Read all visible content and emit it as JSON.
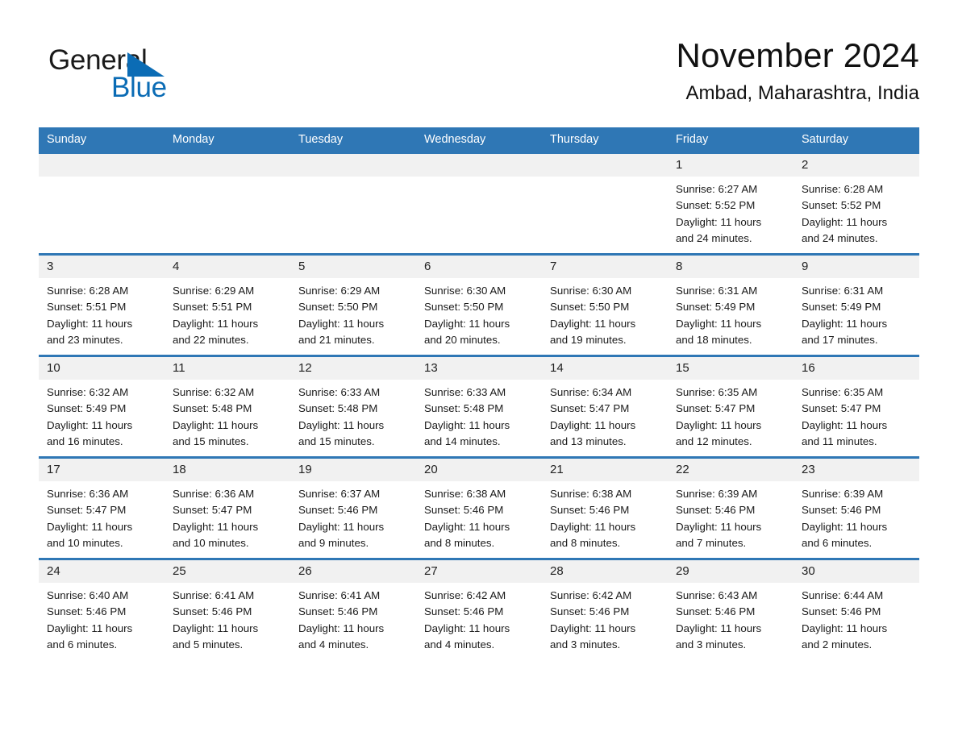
{
  "brand": {
    "name_part1": "General",
    "name_part2": "Blue",
    "accent_color": "#0b6cb5"
  },
  "header": {
    "month_title": "November 2024",
    "location": "Ambad, Maharashtra, India"
  },
  "theme": {
    "header_bar_color": "#2f77b5",
    "daynum_bg": "#f1f1f1"
  },
  "weekdays": [
    "Sunday",
    "Monday",
    "Tuesday",
    "Wednesday",
    "Thursday",
    "Friday",
    "Saturday"
  ],
  "weeks": [
    [
      {
        "day": "",
        "sunrise": "",
        "sunset": "",
        "daylight_line1": "",
        "daylight_line2": ""
      },
      {
        "day": "",
        "sunrise": "",
        "sunset": "",
        "daylight_line1": "",
        "daylight_line2": ""
      },
      {
        "day": "",
        "sunrise": "",
        "sunset": "",
        "daylight_line1": "",
        "daylight_line2": ""
      },
      {
        "day": "",
        "sunrise": "",
        "sunset": "",
        "daylight_line1": "",
        "daylight_line2": ""
      },
      {
        "day": "",
        "sunrise": "",
        "sunset": "",
        "daylight_line1": "",
        "daylight_line2": ""
      },
      {
        "day": "1",
        "sunrise": "Sunrise: 6:27 AM",
        "sunset": "Sunset: 5:52 PM",
        "daylight_line1": "Daylight: 11 hours",
        "daylight_line2": "and 24 minutes."
      },
      {
        "day": "2",
        "sunrise": "Sunrise: 6:28 AM",
        "sunset": "Sunset: 5:52 PM",
        "daylight_line1": "Daylight: 11 hours",
        "daylight_line2": "and 24 minutes."
      }
    ],
    [
      {
        "day": "3",
        "sunrise": "Sunrise: 6:28 AM",
        "sunset": "Sunset: 5:51 PM",
        "daylight_line1": "Daylight: 11 hours",
        "daylight_line2": "and 23 minutes."
      },
      {
        "day": "4",
        "sunrise": "Sunrise: 6:29 AM",
        "sunset": "Sunset: 5:51 PM",
        "daylight_line1": "Daylight: 11 hours",
        "daylight_line2": "and 22 minutes."
      },
      {
        "day": "5",
        "sunrise": "Sunrise: 6:29 AM",
        "sunset": "Sunset: 5:50 PM",
        "daylight_line1": "Daylight: 11 hours",
        "daylight_line2": "and 21 minutes."
      },
      {
        "day": "6",
        "sunrise": "Sunrise: 6:30 AM",
        "sunset": "Sunset: 5:50 PM",
        "daylight_line1": "Daylight: 11 hours",
        "daylight_line2": "and 20 minutes."
      },
      {
        "day": "7",
        "sunrise": "Sunrise: 6:30 AM",
        "sunset": "Sunset: 5:50 PM",
        "daylight_line1": "Daylight: 11 hours",
        "daylight_line2": "and 19 minutes."
      },
      {
        "day": "8",
        "sunrise": "Sunrise: 6:31 AM",
        "sunset": "Sunset: 5:49 PM",
        "daylight_line1": "Daylight: 11 hours",
        "daylight_line2": "and 18 minutes."
      },
      {
        "day": "9",
        "sunrise": "Sunrise: 6:31 AM",
        "sunset": "Sunset: 5:49 PM",
        "daylight_line1": "Daylight: 11 hours",
        "daylight_line2": "and 17 minutes."
      }
    ],
    [
      {
        "day": "10",
        "sunrise": "Sunrise: 6:32 AM",
        "sunset": "Sunset: 5:49 PM",
        "daylight_line1": "Daylight: 11 hours",
        "daylight_line2": "and 16 minutes."
      },
      {
        "day": "11",
        "sunrise": "Sunrise: 6:32 AM",
        "sunset": "Sunset: 5:48 PM",
        "daylight_line1": "Daylight: 11 hours",
        "daylight_line2": "and 15 minutes."
      },
      {
        "day": "12",
        "sunrise": "Sunrise: 6:33 AM",
        "sunset": "Sunset: 5:48 PM",
        "daylight_line1": "Daylight: 11 hours",
        "daylight_line2": "and 15 minutes."
      },
      {
        "day": "13",
        "sunrise": "Sunrise: 6:33 AM",
        "sunset": "Sunset: 5:48 PM",
        "daylight_line1": "Daylight: 11 hours",
        "daylight_line2": "and 14 minutes."
      },
      {
        "day": "14",
        "sunrise": "Sunrise: 6:34 AM",
        "sunset": "Sunset: 5:47 PM",
        "daylight_line1": "Daylight: 11 hours",
        "daylight_line2": "and 13 minutes."
      },
      {
        "day": "15",
        "sunrise": "Sunrise: 6:35 AM",
        "sunset": "Sunset: 5:47 PM",
        "daylight_line1": "Daylight: 11 hours",
        "daylight_line2": "and 12 minutes."
      },
      {
        "day": "16",
        "sunrise": "Sunrise: 6:35 AM",
        "sunset": "Sunset: 5:47 PM",
        "daylight_line1": "Daylight: 11 hours",
        "daylight_line2": "and 11 minutes."
      }
    ],
    [
      {
        "day": "17",
        "sunrise": "Sunrise: 6:36 AM",
        "sunset": "Sunset: 5:47 PM",
        "daylight_line1": "Daylight: 11 hours",
        "daylight_line2": "and 10 minutes."
      },
      {
        "day": "18",
        "sunrise": "Sunrise: 6:36 AM",
        "sunset": "Sunset: 5:47 PM",
        "daylight_line1": "Daylight: 11 hours",
        "daylight_line2": "and 10 minutes."
      },
      {
        "day": "19",
        "sunrise": "Sunrise: 6:37 AM",
        "sunset": "Sunset: 5:46 PM",
        "daylight_line1": "Daylight: 11 hours",
        "daylight_line2": "and 9 minutes."
      },
      {
        "day": "20",
        "sunrise": "Sunrise: 6:38 AM",
        "sunset": "Sunset: 5:46 PM",
        "daylight_line1": "Daylight: 11 hours",
        "daylight_line2": "and 8 minutes."
      },
      {
        "day": "21",
        "sunrise": "Sunrise: 6:38 AM",
        "sunset": "Sunset: 5:46 PM",
        "daylight_line1": "Daylight: 11 hours",
        "daylight_line2": "and 8 minutes."
      },
      {
        "day": "22",
        "sunrise": "Sunrise: 6:39 AM",
        "sunset": "Sunset: 5:46 PM",
        "daylight_line1": "Daylight: 11 hours",
        "daylight_line2": "and 7 minutes."
      },
      {
        "day": "23",
        "sunrise": "Sunrise: 6:39 AM",
        "sunset": "Sunset: 5:46 PM",
        "daylight_line1": "Daylight: 11 hours",
        "daylight_line2": "and 6 minutes."
      }
    ],
    [
      {
        "day": "24",
        "sunrise": "Sunrise: 6:40 AM",
        "sunset": "Sunset: 5:46 PM",
        "daylight_line1": "Daylight: 11 hours",
        "daylight_line2": "and 6 minutes."
      },
      {
        "day": "25",
        "sunrise": "Sunrise: 6:41 AM",
        "sunset": "Sunset: 5:46 PM",
        "daylight_line1": "Daylight: 11 hours",
        "daylight_line2": "and 5 minutes."
      },
      {
        "day": "26",
        "sunrise": "Sunrise: 6:41 AM",
        "sunset": "Sunset: 5:46 PM",
        "daylight_line1": "Daylight: 11 hours",
        "daylight_line2": "and 4 minutes."
      },
      {
        "day": "27",
        "sunrise": "Sunrise: 6:42 AM",
        "sunset": "Sunset: 5:46 PM",
        "daylight_line1": "Daylight: 11 hours",
        "daylight_line2": "and 4 minutes."
      },
      {
        "day": "28",
        "sunrise": "Sunrise: 6:42 AM",
        "sunset": "Sunset: 5:46 PM",
        "daylight_line1": "Daylight: 11 hours",
        "daylight_line2": "and 3 minutes."
      },
      {
        "day": "29",
        "sunrise": "Sunrise: 6:43 AM",
        "sunset": "Sunset: 5:46 PM",
        "daylight_line1": "Daylight: 11 hours",
        "daylight_line2": "and 3 minutes."
      },
      {
        "day": "30",
        "sunrise": "Sunrise: 6:44 AM",
        "sunset": "Sunset: 5:46 PM",
        "daylight_line1": "Daylight: 11 hours",
        "daylight_line2": "and 2 minutes."
      }
    ]
  ]
}
